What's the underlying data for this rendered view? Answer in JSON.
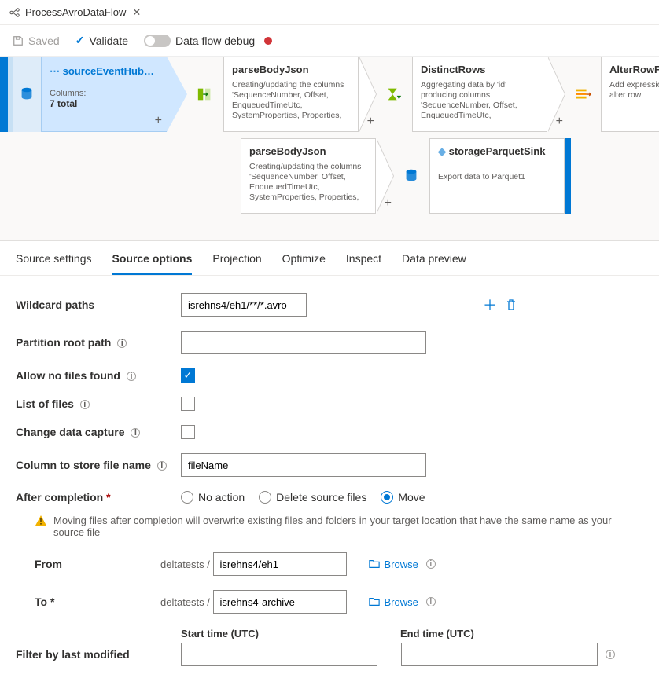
{
  "title": "ProcessAvroDataFlow",
  "toolbar": {
    "saved": "Saved",
    "validate": "Validate",
    "debug": "Data flow debug"
  },
  "canvas": {
    "source": {
      "name": "sourceEventHubsCap...",
      "columnsLabel": "Columns:",
      "columnsValue": "7 total"
    },
    "steps": [
      {
        "name": "parseBodyJson",
        "desc": "Creating/updating the columns 'SequenceNumber, Offset, EnqueuedTimeUtc, SystemProperties, Properties,"
      },
      {
        "name": "DistinctRows",
        "desc": "Aggregating data by 'id' producing columns 'SequenceNumber, Offset, EnqueuedTimeUtc,"
      },
      {
        "name": "AlterRowForUpsert",
        "desc": "Add expressions to alter row"
      }
    ],
    "row2": {
      "step": {
        "name": "parseBodyJson",
        "desc": "Creating/updating the columns 'SequenceNumber, Offset, EnqueuedTimeUtc, SystemProperties, Properties,"
      },
      "sink": {
        "name": "storageParquetSink",
        "desc": "Export data to Parquet1"
      }
    }
  },
  "tabs": [
    "Source settings",
    "Source options",
    "Projection",
    "Optimize",
    "Inspect",
    "Data preview"
  ],
  "activeTab": 1,
  "form": {
    "wildcardLabel": "Wildcard paths",
    "wildcardValue": "isrehns4/eh1/**/*.avro",
    "partitionLabel": "Partition root path",
    "partitionValue": "",
    "allowNoFilesLabel": "Allow no files found",
    "allowNoFilesChecked": true,
    "listOfFilesLabel": "List of files",
    "cdcLabel": "Change data capture",
    "colStoreLabel": "Column to store file name",
    "colStoreValue": "fileName",
    "afterCompletionLabel": "After completion",
    "afterCompletionOptions": [
      "No action",
      "Delete source files",
      "Move"
    ],
    "afterCompletionSelected": 2,
    "warnText": "Moving files after completion will overwrite existing files and folders in your target location that have the same name as your source file",
    "fromLabel": "From",
    "fromBase": "deltatests",
    "fromValue": "isrehns4/eh1",
    "toLabel": "To",
    "toBase": "deltatests",
    "toValue": "isrehns4-archive",
    "browseLabel": "Browse",
    "startTimeLabel": "Start time (UTC)",
    "endTimeLabel": "End time (UTC)",
    "filterLabel": "Filter by last modified"
  }
}
